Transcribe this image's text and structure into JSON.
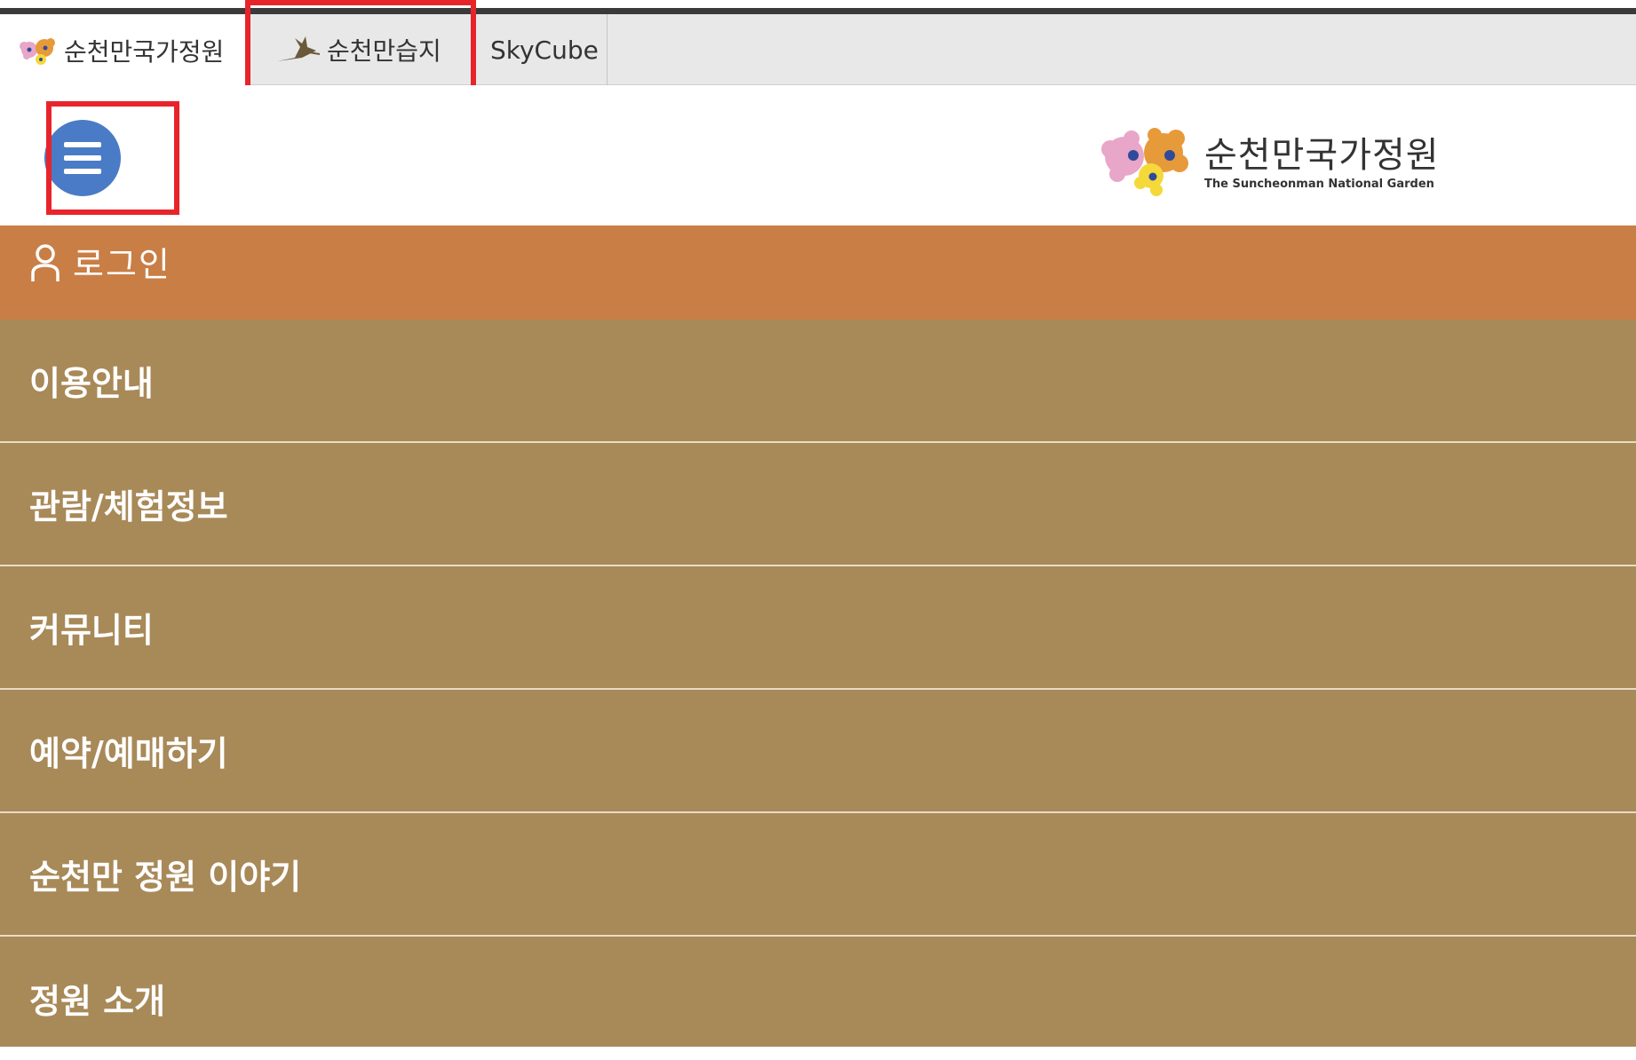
{
  "site_tabs": [
    {
      "label": "순천만국가정원",
      "icon": "garden-flower-icon",
      "active": true
    },
    {
      "label": "순천만습지",
      "icon": "crane-bird-icon",
      "active": false
    },
    {
      "label": "SkyCube",
      "icon": null,
      "active": false
    }
  ],
  "header": {
    "menu_icon": "hamburger-menu-icon",
    "logo": {
      "name_ko": "순천만국가정원",
      "name_en": "The Suncheonman National Garden"
    }
  },
  "login": {
    "icon": "user-icon",
    "label": "로그인"
  },
  "menu": {
    "items": [
      {
        "label": "이용안내"
      },
      {
        "label": "관람/체험정보"
      },
      {
        "label": "커뮤니티"
      },
      {
        "label": "예약/예매하기"
      },
      {
        "label": "순천만 정원 이야기"
      },
      {
        "label": "정원 소개"
      }
    ]
  },
  "colors": {
    "menu_button": "#4a7bc6",
    "login_bar": "#c97e45",
    "menu_bg": "#a88958",
    "highlight": "#e8242b"
  }
}
